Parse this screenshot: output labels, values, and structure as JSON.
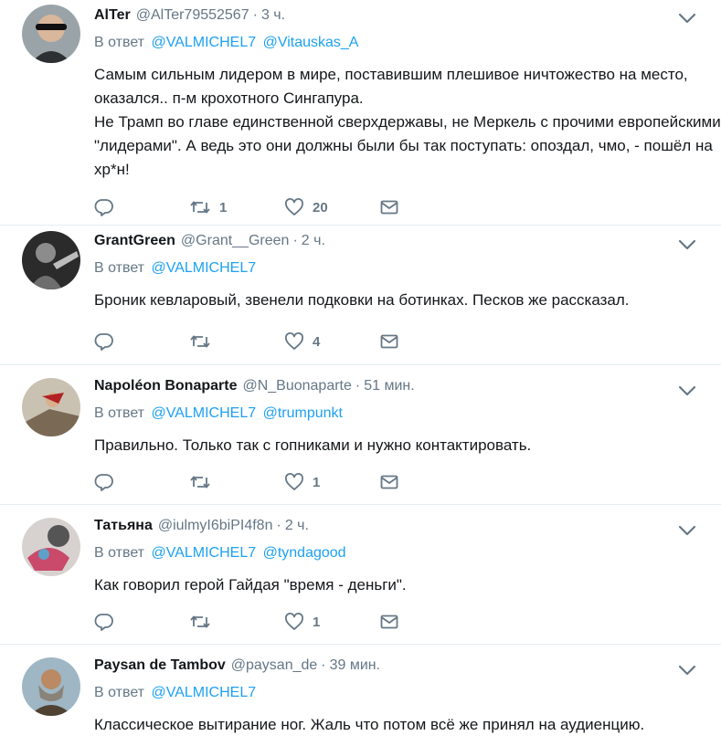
{
  "reply_prefix": "В ответ",
  "tweets": [
    {
      "name": "AlTer",
      "handle": "@AlTer79552567",
      "time": "3 ч.",
      "mentions": [
        "@VALMICHEL7",
        "@Vitauskas_A"
      ],
      "text": "Самым сильным лидером в мире, поставившим плешивое ничтожество на место, оказался.. п-м крохотного Сингапура.\nНе Трамп во главе единственной сверхдержавы, не Меркель с прочими европейскими \"лидерами\". А ведь это они должны были бы так поступать: опоздал, чмо, - пошёл на хр*н!",
      "retweets": "1",
      "likes": "20"
    },
    {
      "name": "GrantGreen",
      "handle": "@Grant__Green",
      "time": "2 ч.",
      "mentions": [
        "@VALMICHEL7"
      ],
      "text": "Броник кевларовый, звенели подковки на ботинках. Песков же рассказал.",
      "retweets": "",
      "likes": "4"
    },
    {
      "name": "Napoléon Bonaparte",
      "handle": "@N_Buonaparte",
      "time": "51 мин.",
      "mentions": [
        "@VALMICHEL7",
        "@trumpunkt"
      ],
      "text": "Правильно. Только так с гопниками и нужно контактировать.",
      "retweets": "",
      "likes": "1"
    },
    {
      "name": "Татьяна",
      "handle": "@iulmyI6biPI4f8n",
      "time": "2 ч.",
      "mentions": [
        "@VALMICHEL7",
        "@tyndagood"
      ],
      "text": "Как говорил герой Гайдая \"время - деньги\".",
      "retweets": "",
      "likes": "1"
    },
    {
      "name": "Paysan de Tambov",
      "handle": "@paysan_de",
      "time": "39 мин.",
      "mentions": [
        "@VALMICHEL7"
      ],
      "text": "Классическое вытирание ног. Жаль что потом всё же принял на аудиенцию.",
      "retweets": "",
      "likes": ""
    }
  ],
  "colors": {
    "link": "#1da1f2",
    "muted": "#657786",
    "text": "#14171a",
    "divider": "#e6ecf0"
  },
  "icons": [
    "reply-icon",
    "retweet-icon",
    "like-icon",
    "message-icon",
    "chevron-down-icon"
  ]
}
